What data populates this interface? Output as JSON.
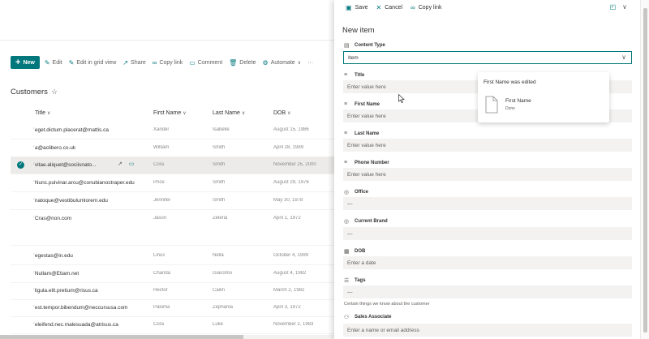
{
  "commandbar": {
    "new_label": "New",
    "edit_label": "Edit",
    "grid_label": "Edit in grid view",
    "share_label": "Share",
    "copylink_label": "Copy link",
    "comment_label": "Comment",
    "delete_label": "Delete",
    "automate_label": "Automate"
  },
  "list": {
    "title": "Customers",
    "columns": [
      "Title",
      "First Name",
      "Last Name",
      "DOB"
    ],
    "rows": [
      {
        "email": "eget.dictum.placerat@mattis.ca",
        "first": "Xander",
        "last": "Isabelle",
        "dob": "August 15, 1986"
      },
      {
        "email": "a@aclibero.co.uk",
        "first": "William",
        "last": "Smith",
        "dob": "April 28, 1989"
      },
      {
        "email": "vitae.aliquet@sociisnato...",
        "first": "Cora",
        "last": "Smith",
        "dob": "November 25, 2000"
      },
      {
        "email": "Nunc.pulvinar.arcu@conubianostraper.edu",
        "first": "Price",
        "last": "Smith",
        "dob": "August 29, 1976"
      },
      {
        "email": "natoque@vestibulumlorem.edu",
        "first": "Jennifer",
        "last": "Smith",
        "dob": "May 30, 1978"
      },
      {
        "email": "Cras@non.com",
        "first": "Jason",
        "last": "Zeleria",
        "dob": "April 1, 1972"
      },
      {
        "email": "egestas@in.edu",
        "first": "Linus",
        "last": "Nella",
        "dob": "October 4, 1999"
      },
      {
        "email": "Nullam@Etiam.net",
        "first": "Chanda",
        "last": "Giacomo",
        "dob": "August 4, 1982"
      },
      {
        "email": "ligula.elit.pretium@risus.ca",
        "first": "Hector",
        "last": "Cailin",
        "dob": "March 2, 1982"
      },
      {
        "email": "est.tempor.bibendum@neccursusa.com",
        "first": "Paloma",
        "last": "Zephania",
        "dob": "April 3, 1972"
      },
      {
        "email": "eleifend.nec.malesuada@atrisus.ca",
        "first": "Cora",
        "last": "Luke",
        "dob": "November 2, 1983"
      }
    ]
  },
  "panel": {
    "save_label": "Save",
    "cancel_label": "Cancel",
    "copylink_label": "Copy link",
    "title": "New item",
    "content_type": {
      "label": "Content Type",
      "value": "Item"
    },
    "fields": {
      "title": {
        "label": "Title",
        "placeholder": "Enter value here"
      },
      "first_name": {
        "label": "First Name",
        "placeholder": "Enter value here"
      },
      "last_name": {
        "label": "Last Name",
        "placeholder": "Enter value here"
      },
      "phone": {
        "label": "Phone Number",
        "placeholder": "Enter value here"
      },
      "office": {
        "label": "Office",
        "value": "—"
      },
      "brand": {
        "label": "Current Brand",
        "value": "—"
      },
      "dob": {
        "label": "DOB",
        "placeholder": "Enter a date"
      },
      "tags": {
        "label": "Tags",
        "value": "—",
        "description": "Certain things we know about the customer"
      },
      "sales": {
        "label": "Sales Associate",
        "placeholder": "Enter a name or email address"
      }
    }
  },
  "toast": {
    "title": "First Name was edited",
    "item_name": "First Name",
    "status": "Done"
  },
  "colors": {
    "accent": "#03787c"
  }
}
